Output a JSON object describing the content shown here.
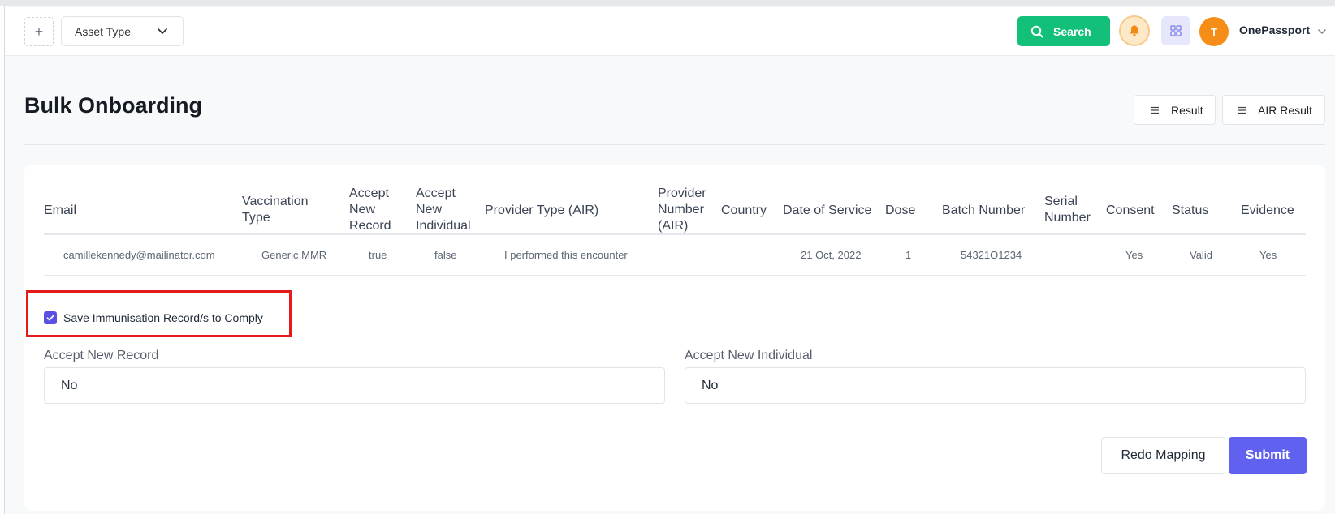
{
  "header": {
    "asset_type_label": "Asset Type",
    "search_label": "Search",
    "avatar_initial": "T",
    "org_name": "OnePassport"
  },
  "page": {
    "title": "Bulk Onboarding",
    "result_label": "Result",
    "air_result_label": "AIR Result"
  },
  "table": {
    "columns": {
      "email": "Email",
      "vaccination_type": "Vaccination Type",
      "accept_new_record": "Accept New Record",
      "accept_new_individual": "Accept New Individual",
      "provider_type": "Provider Type (AIR)",
      "provider_number": "Provider Number (AIR)",
      "country": "Country",
      "date_of_service": "Date of Service",
      "dose": "Dose",
      "batch_number": "Batch Number",
      "serial_number": "Serial Number",
      "consent": "Consent",
      "status": "Status",
      "evidence": "Evidence"
    },
    "rows": [
      {
        "email": "camillekennedy@mailinator.com",
        "vaccination_type": "Generic MMR",
        "accept_new_record": "true",
        "accept_new_individual": "false",
        "provider_type": "I performed this encounter",
        "provider_number": "",
        "country": "",
        "date_of_service": "21 Oct, 2022",
        "dose": "1",
        "batch_number": "54321O1234",
        "serial_number": "",
        "consent": "Yes",
        "status": "Valid",
        "evidence": "Yes"
      }
    ]
  },
  "form": {
    "save_checkbox_label": "Save Immunisation Record/s to Comply",
    "save_checked": true,
    "accept_new_record_label": "Accept New Record",
    "accept_new_record_value": "No",
    "accept_new_individual_label": "Accept New Individual",
    "accept_new_individual_value": "No"
  },
  "actions": {
    "redo_mapping_label": "Redo Mapping",
    "submit_label": "Submit"
  },
  "colors": {
    "search_green": "#12c07a",
    "primary_purple": "#6161f0",
    "avatar_orange": "#f68d16",
    "highlight_red": "#e31b1b"
  }
}
